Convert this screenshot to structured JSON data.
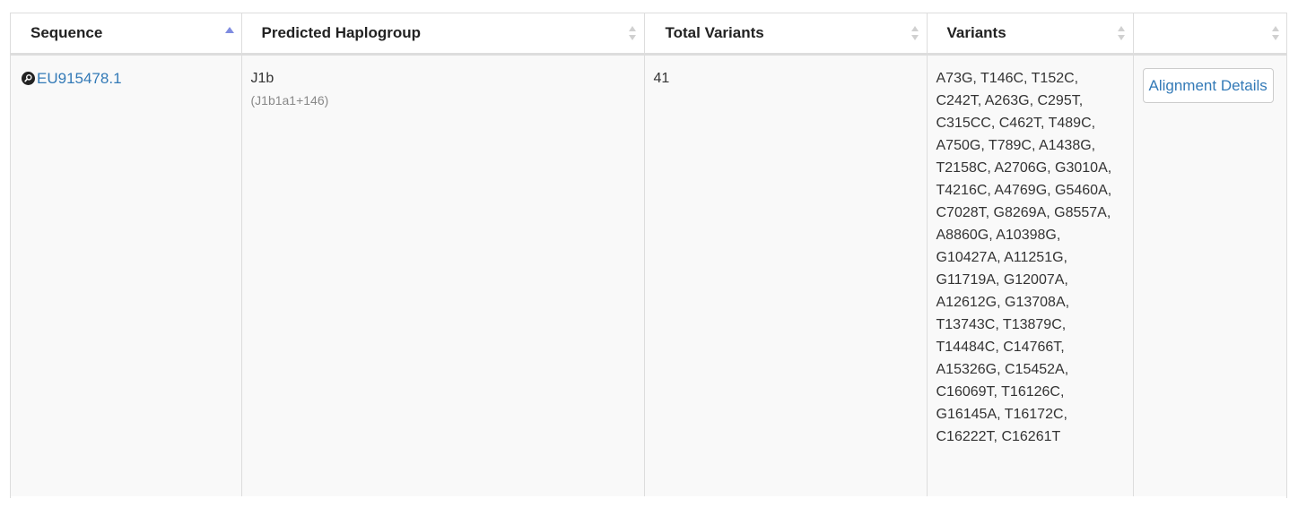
{
  "table": {
    "headers": [
      {
        "label": "Sequence",
        "sort": "asc"
      },
      {
        "label": "Predicted Haplogroup",
        "sort": "none"
      },
      {
        "label": "Total Variants",
        "sort": "none"
      },
      {
        "label": "Variants",
        "sort": "none"
      },
      {
        "label": "",
        "sort": "none"
      }
    ],
    "rows": [
      {
        "sequence": "EU915478.1",
        "haplogroup": "J1b",
        "haplogroup_detail": "(J1b1a1+146)",
        "total_variants": "41",
        "variants": "A73G, T146C, T152C, C242T, A263G, C295T, C315CC, C462T, T489C, A750G, T789C, A1438G, T2158C, A2706G, G3010A, T4216C, A4769G, G5460A, C7028T, G8269A, G8557A, A8860G, A10398G, G10427A, A11251G, G11719A, G12007A, A12612G, G13708A, T13743C, T13879C, T14484C, C14766T, A15326G, C15452A, C16069T, T16126C, G16145A, T16172C, C16222T, C16261T",
        "action_label": "Alignment Details"
      }
    ]
  },
  "colors": {
    "link": "#337ab7",
    "sort_active": "#7f8ce0",
    "sort_inactive": "#d0d0d0",
    "border": "#dddddd",
    "row_bg": "#f9f9f9"
  },
  "icons": {
    "sequence_icon": "magnifier-badge-icon",
    "sort_asc": "sort-asc-icon",
    "sort_both": "sort-both-icon"
  }
}
